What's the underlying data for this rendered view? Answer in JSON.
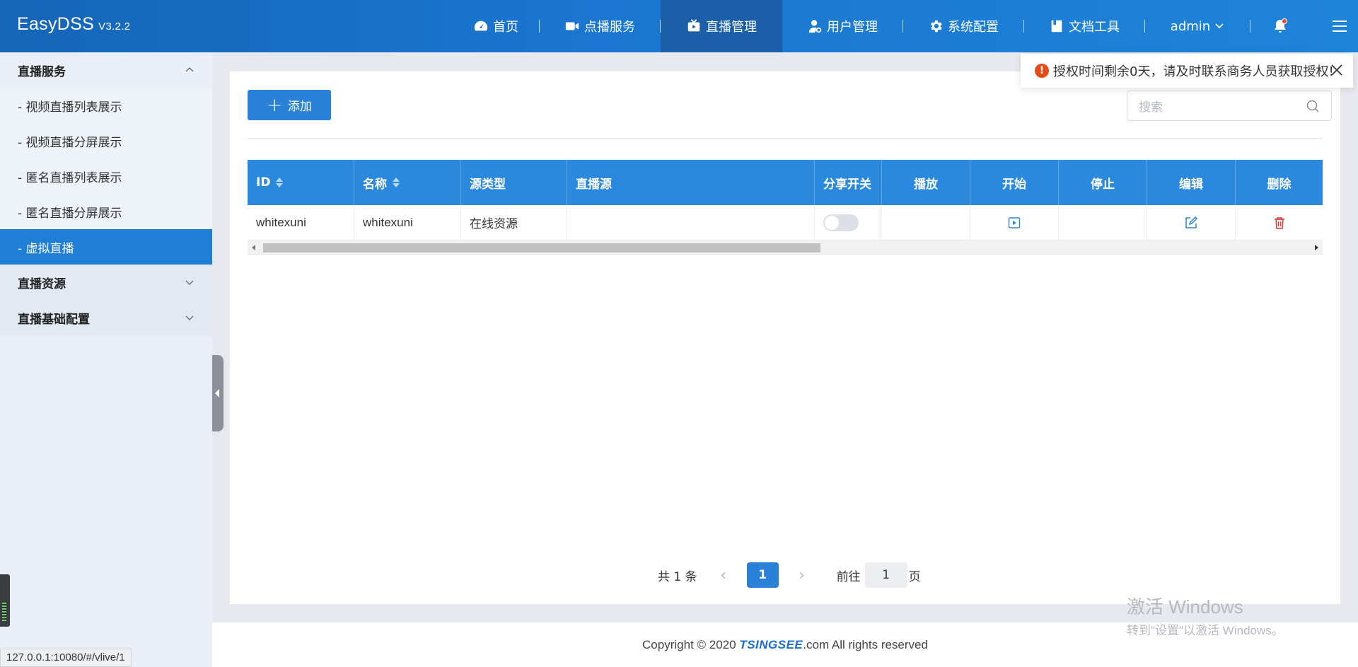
{
  "header": {
    "brand": "EasyDSS",
    "version": "V3.2.2",
    "nav": [
      {
        "label": "首页",
        "icon": "dashboard-icon"
      },
      {
        "label": "点播服务",
        "icon": "video-camera-icon"
      },
      {
        "label": "直播管理",
        "icon": "live-tv-icon",
        "active": true
      },
      {
        "label": "用户管理",
        "icon": "user-icon"
      },
      {
        "label": "系统配置",
        "icon": "gear-icon"
      },
      {
        "label": "文档工具",
        "icon": "document-icon"
      }
    ],
    "user": "admin",
    "accent_color": "#1e84d9"
  },
  "sidebar": {
    "groups": [
      {
        "label": "直播服务",
        "expanded": true,
        "items": [
          {
            "label": "- 视频直播列表展示"
          },
          {
            "label": "- 视频直播分屏展示"
          },
          {
            "label": "- 匿名直播列表展示"
          },
          {
            "label": "- 匿名直播分屏展示"
          },
          {
            "label": "- 虚拟直播",
            "active": true
          }
        ]
      },
      {
        "label": "直播资源",
        "expanded": false
      },
      {
        "label": "直播基础配置",
        "expanded": false
      }
    ]
  },
  "toolbar": {
    "add_label": "添加",
    "search_placeholder": "搜索"
  },
  "table": {
    "columns": [
      "ID",
      "名称",
      "源类型",
      "直播源",
      "分享开关",
      "播放",
      "开始",
      "停止",
      "编辑",
      "删除"
    ],
    "rows": [
      {
        "id": "whitexuni",
        "name": "whitexuni",
        "source_type": "在线资源",
        "source": "",
        "share": false
      }
    ]
  },
  "pagination": {
    "total": "共 1 条",
    "current": "1",
    "goto_label": "前往",
    "goto_value": "1",
    "page_suffix": "页"
  },
  "notice": {
    "text": "授权时间剩余0天，请及时联系商务人员获取授权!",
    "color": "#e64a19"
  },
  "footer": {
    "prefix": "Copyright © 2020 ",
    "brand": "TSINGSEE",
    "suffix": ".com All rights reserved"
  },
  "status_url": "127.0.0.1:10080/#/vlive/1",
  "watermark": {
    "line1": "激活 Windows",
    "line2": "转到\"设置\"以激活 Windows。"
  }
}
